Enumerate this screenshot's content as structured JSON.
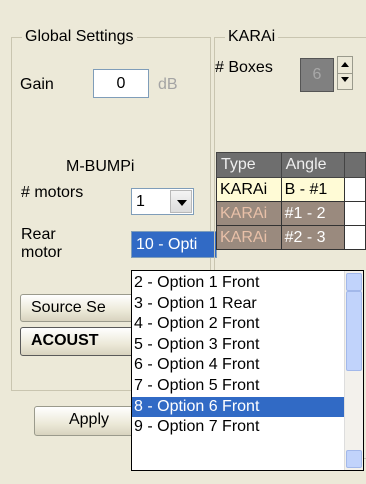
{
  "global_settings": {
    "title": "Global Settings",
    "gain_label": "Gain",
    "gain_value": "0",
    "gain_unit": "dB"
  },
  "karai": {
    "title": "KARAi",
    "boxes_label": "# Boxes",
    "boxes_value": "6"
  },
  "mbumpi": {
    "title": "M-BUMPi",
    "motors_label": "# motors",
    "motors_value": "1",
    "rear_motor_label_1": "Rear",
    "rear_motor_label_2": "motor",
    "rear_motor_value": "10 - Opti"
  },
  "buttons": {
    "source_settings": "Source Se",
    "acoustic": "ACOUST",
    "apply": "Apply"
  },
  "table": {
    "headers": [
      "Type",
      "Angle"
    ],
    "rows": [
      {
        "type": "KARAi",
        "angle": "B - #1"
      },
      {
        "type": "KARAi",
        "angle": "#1 - 2"
      },
      {
        "type": "KARAi",
        "angle": "#2 - 3"
      }
    ]
  },
  "dropdown": {
    "options": [
      "2 - Option 1 Front",
      "3 - Option 1 Rear",
      "4 - Option 2 Front",
      "5 - Option 3 Front",
      "6 - Option 4 Front",
      "7 - Option 5 Front",
      "8 - Option 6 Front",
      "9 - Option 7 Front"
    ],
    "selected_index": 6
  },
  "colors": {
    "selection": "#316ac5",
    "row_light": "#fffbd6",
    "row_dark": "#9a8a7e",
    "header": "#6e6e6e"
  }
}
